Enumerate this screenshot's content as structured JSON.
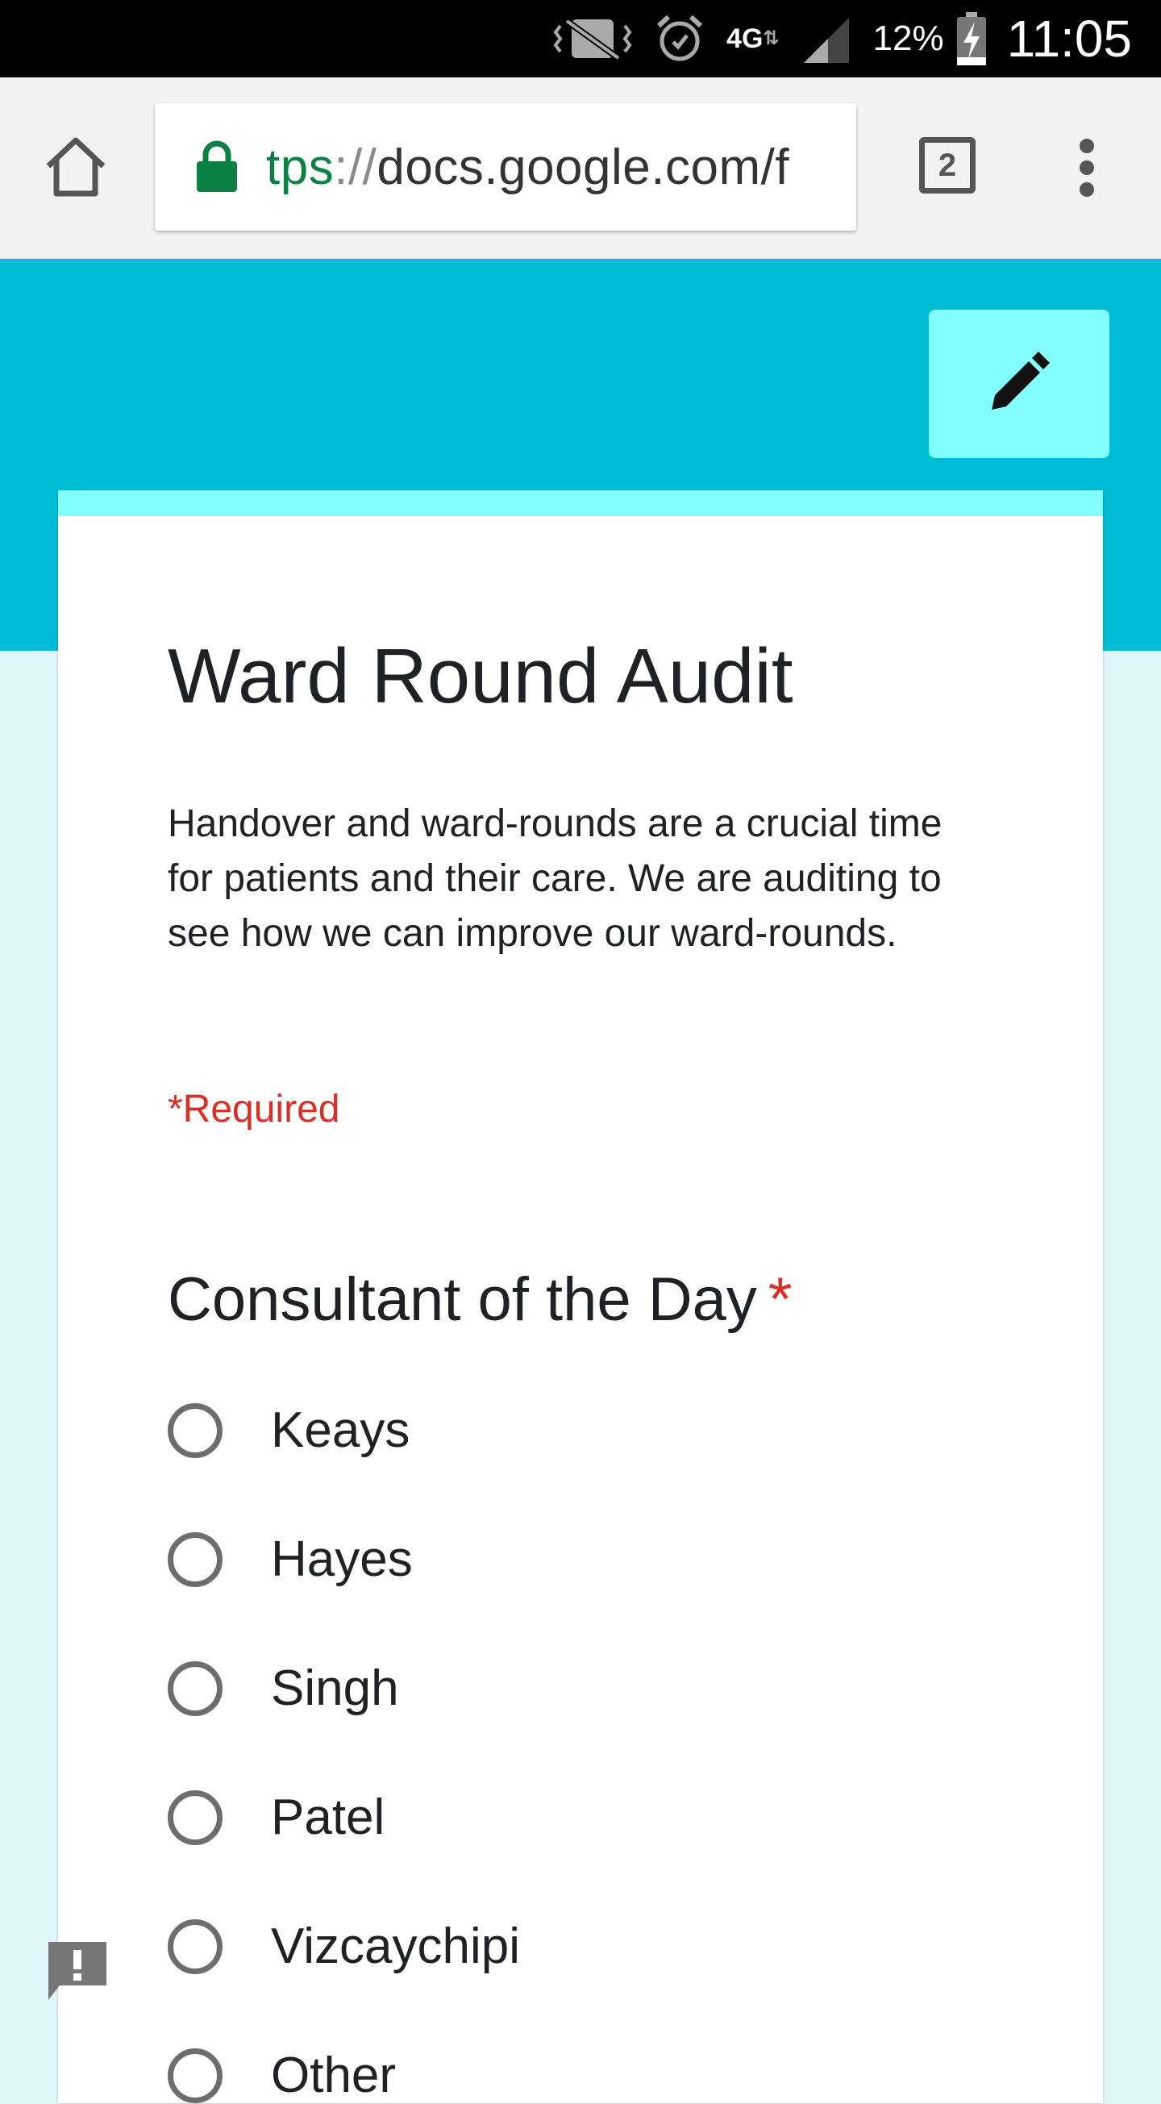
{
  "status_bar": {
    "battery": "12%",
    "time": "11:05",
    "network": "4G",
    "icons": [
      "vibrate-icon",
      "alarm-icon",
      "network-4g-icon",
      "signal-icon",
      "battery-charging-icon"
    ]
  },
  "browser": {
    "url_scheme": "tps",
    "url_sep": "://",
    "url_host": "docs.google.com/f",
    "tab_count": "2",
    "colors": {
      "secure": "#0b8043"
    }
  },
  "form": {
    "title": "Ward Round Audit",
    "description": "Handover and ward-rounds are a crucial time for patients and their care. We are auditing to see how we can improve our ward-rounds.",
    "required_note": "*Required",
    "colors": {
      "header": "#00bcd4",
      "accent": "#84ffff",
      "required": "#d93025",
      "background": "#e0f7fa"
    }
  },
  "question": {
    "title": "Consultant of the Day",
    "required_mark": "*",
    "options": [
      {
        "label": "Keays",
        "selected": false
      },
      {
        "label": "Hayes",
        "selected": false
      },
      {
        "label": "Singh",
        "selected": false
      },
      {
        "label": "Patel",
        "selected": false
      },
      {
        "label": "Vizcaychipi",
        "selected": false
      },
      {
        "label": "Other",
        "selected": false
      }
    ]
  }
}
